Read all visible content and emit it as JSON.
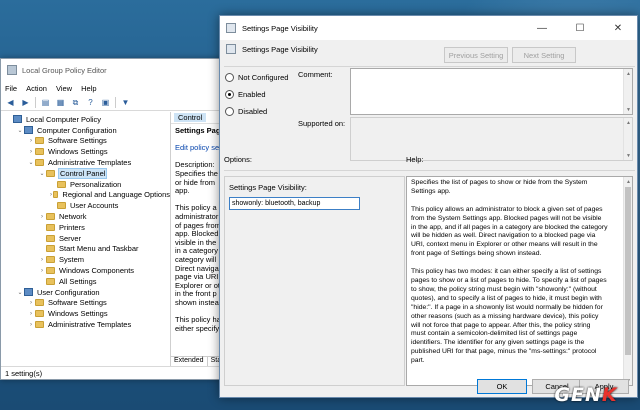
{
  "gpe": {
    "title": "Local Group Policy Editor",
    "menu": [
      "File",
      "Action",
      "View",
      "Help"
    ],
    "tree": [
      {
        "label": "Local Computer Policy",
        "depth": 0,
        "expander": "",
        "icon": "pc"
      },
      {
        "label": "Computer Configuration",
        "depth": 1,
        "expander": "⌄",
        "icon": "pc"
      },
      {
        "label": "Software Settings",
        "depth": 2,
        "expander": "›",
        "icon": "folder"
      },
      {
        "label": "Windows Settings",
        "depth": 2,
        "expander": "›",
        "icon": "folder"
      },
      {
        "label": "Administrative Templates",
        "depth": 2,
        "expander": "⌄",
        "icon": "folder"
      },
      {
        "label": "Control Panel",
        "depth": 3,
        "expander": "⌄",
        "icon": "folder",
        "selected": true
      },
      {
        "label": "Personalization",
        "depth": 4,
        "expander": "",
        "icon": "folder"
      },
      {
        "label": "Regional and Language Options",
        "depth": 4,
        "expander": "›",
        "icon": "folder"
      },
      {
        "label": "User Accounts",
        "depth": 4,
        "expander": "",
        "icon": "folder"
      },
      {
        "label": "Network",
        "depth": 3,
        "expander": "›",
        "icon": "folder"
      },
      {
        "label": "Printers",
        "depth": 3,
        "expander": "",
        "icon": "folder"
      },
      {
        "label": "Server",
        "depth": 3,
        "expander": "",
        "icon": "folder"
      },
      {
        "label": "Start Menu and Taskbar",
        "depth": 3,
        "expander": "",
        "icon": "folder"
      },
      {
        "label": "System",
        "depth": 3,
        "expander": "›",
        "icon": "folder"
      },
      {
        "label": "Windows Components",
        "depth": 3,
        "expander": "›",
        "icon": "folder"
      },
      {
        "label": "All Settings",
        "depth": 3,
        "expander": "",
        "icon": "folder"
      },
      {
        "label": "User Configuration",
        "depth": 1,
        "expander": "⌄",
        "icon": "pc"
      },
      {
        "label": "Software Settings",
        "depth": 2,
        "expander": "›",
        "icon": "folder"
      },
      {
        "label": "Windows Settings",
        "depth": 2,
        "expander": "›",
        "icon": "folder"
      },
      {
        "label": "Administrative Templates",
        "depth": 2,
        "expander": "›",
        "icon": "folder"
      }
    ],
    "right_header": "Control",
    "right_lines": [
      "Settings Pag",
      "",
      "Edit policy se",
      "",
      "Description:",
      "Specifies the",
      "or hide from",
      "app.",
      "",
      "This policy a",
      "administrator",
      "of pages from",
      "app. Blocked",
      "visible in the",
      "in a category",
      "category will",
      "Direct naviga",
      "page via URI,",
      "Explorer or ot",
      "in the front p",
      "shown instea",
      "",
      "This policy ha",
      "either specify"
    ],
    "tabs": [
      "Extended",
      "Standard"
    ],
    "status": "1 setting(s)"
  },
  "dialog": {
    "title": "Settings Page Visibility",
    "subtitle": "Settings Page Visibility",
    "prev_btn": "Previous Setting",
    "next_btn": "Next Setting",
    "radios": [
      "Not Configured",
      "Enabled",
      "Disabled"
    ],
    "selected_radio": "Enabled",
    "comment_label": "Comment:",
    "supported_label": "Supported on:",
    "options_label": "Options:",
    "help_label": "Help:",
    "option_field_label": "Settings Page Visibility:",
    "option_field_value": "showonly: bluetooth, backup",
    "help_text": "Specifies the list of pages to show or hide from the System\nSettings app.\n\nThis policy allows an administrator to block a given set of pages\nfrom the System Settings app. Blocked pages will not be visible\nin the app, and if all pages in a category are blocked the category\nwill be hidden as well. Direct navigation to a blocked page via\nURI, context menu in Explorer or other means will result in the\nfront page of Settings being shown instead.\n\nThis policy has two modes: it can either specify a list of settings\npages to show or a list of pages to hide. To specify a list of pages\nto show, the policy string must begin with \"showonly:\" (without\nquotes), and to specify a list of pages to hide, it must begin with\n\"hide:\". If a page in a showonly list would normally be hidden for\nother reasons (such as a missing hardware device), this policy\nwill not force that page to appear. After this, the policy string\nmust contain a semicolon-delimited list of settings page\nidentifiers. The identifier for any given settings page is the\npublished URI for that page, minus the \"ms-settings:\" protocol\npart.",
    "ok": "OK",
    "cancel": "Cancel",
    "apply": "Apply"
  },
  "watermark": {
    "text_a": "GEN",
    "text_b": "K"
  }
}
